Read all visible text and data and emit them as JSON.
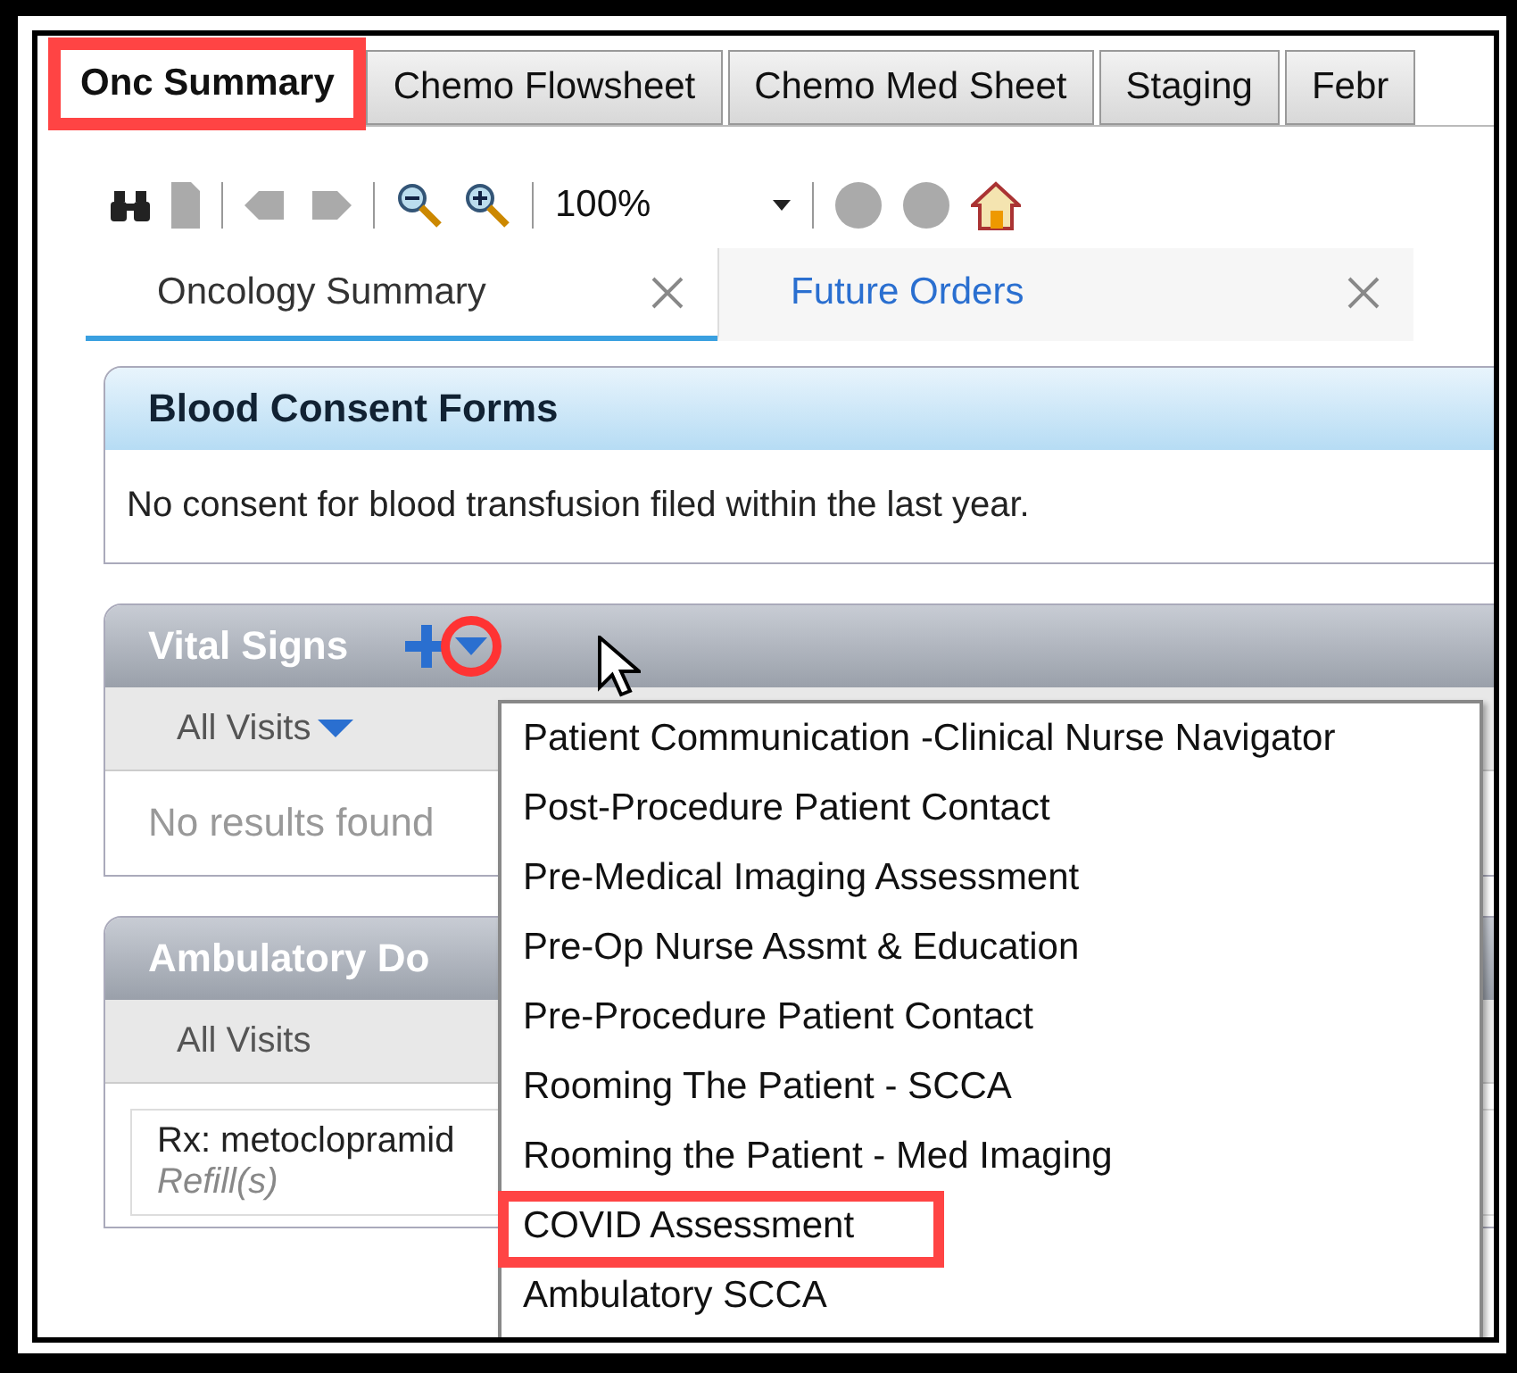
{
  "tabs": [
    {
      "label": "Onc Summary",
      "selected": true,
      "highlighted": true
    },
    {
      "label": "Chemo Flowsheet",
      "selected": false,
      "highlighted": false
    },
    {
      "label": "Chemo Med Sheet",
      "selected": false,
      "highlighted": false
    },
    {
      "label": "Staging",
      "selected": false,
      "highlighted": false
    },
    {
      "label": "Febr",
      "selected": false,
      "highlighted": false
    }
  ],
  "toolbar": {
    "zoom": "100%"
  },
  "view_tabs": [
    {
      "label": "Oncology Summary",
      "selected": true
    },
    {
      "label": "Future Orders",
      "selected": false
    }
  ],
  "panels": [
    {
      "kind": "info",
      "title": "Blood Consent Forms",
      "message": "No consent for blood transfusion filed within the last year."
    },
    {
      "kind": "results",
      "title": "Vital Signs",
      "add_button": true,
      "menu_button_highlighted": true,
      "filter": "All Visits",
      "filter_menu": true,
      "message": "No results found"
    },
    {
      "kind": "documents",
      "title": "Ambulatory Do",
      "filter": "All Visits",
      "rows": [
        {
          "text": "Rx: metoclopramid",
          "note": "Refill(s)"
        }
      ]
    }
  ],
  "menu": {
    "items": [
      {
        "label": "Patient Communication -Clinical Nurse Navigator",
        "highlighted": false
      },
      {
        "label": "Post-Procedure Patient Contact",
        "highlighted": false
      },
      {
        "label": "Pre-Medical Imaging Assessment",
        "highlighted": false
      },
      {
        "label": "Pre-Op Nurse Assmt & Education",
        "highlighted": false
      },
      {
        "label": "Pre-Procedure Patient Contact",
        "highlighted": false
      },
      {
        "label": "Rooming The Patient - SCCA",
        "highlighted": false
      },
      {
        "label": "Rooming the Patient - Med Imaging",
        "highlighted": false
      },
      {
        "label": "COVID Assessment",
        "highlighted": true
      },
      {
        "label": "Ambulatory SCCA",
        "highlighted": false
      }
    ]
  }
}
